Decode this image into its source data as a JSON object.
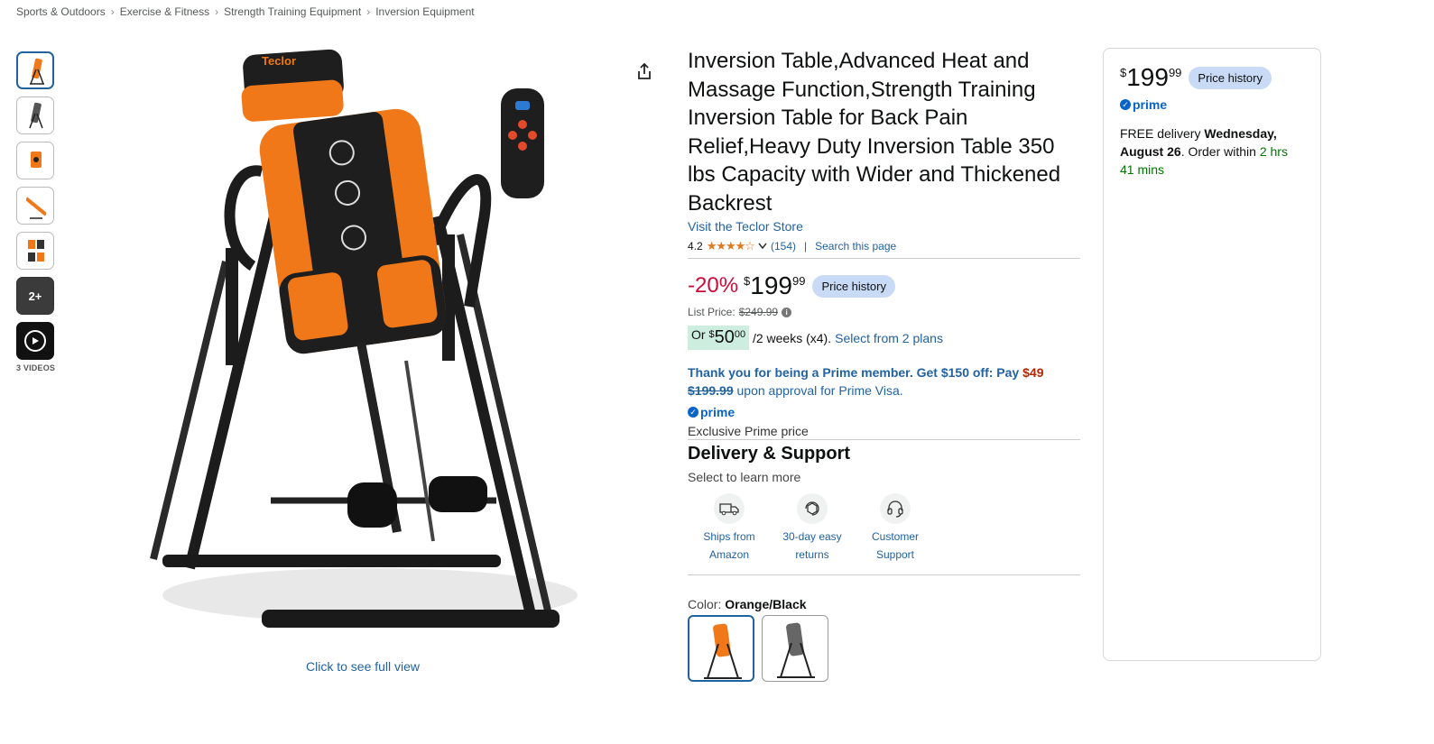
{
  "breadcrumb": [
    "Sports & Outdoors",
    "Exercise & Fitness",
    "Strength Training Equipment",
    "Inversion Equipment"
  ],
  "gallery": {
    "more_count": "2+",
    "videos_label": "3 VIDEOS",
    "full_view": "Click to see full view",
    "brand_text": "Teclor"
  },
  "product": {
    "title": "Inversion Table,Advanced Heat and Massage Function,Strength Training Inversion Table for Back Pain Relief,Heavy Duty Inversion Table 350 lbs Capacity with Wider and Thickened Backrest",
    "store_link": "Visit the Teclor Store",
    "rating": "4.2",
    "stars": "★★★★☆",
    "reviews": "(154)",
    "search_page": "Search this page"
  },
  "pricing": {
    "discount": "-20%",
    "currency": "$",
    "whole": "199",
    "fraction": "99",
    "history_label": "Price history",
    "list_price_label": "List Price:",
    "list_price": "$249.99",
    "install_or": "Or",
    "install_currency": "$",
    "install_whole": "50",
    "install_fraction": "00",
    "install_term": "/2 weeks (x4).",
    "install_plans": "Select from 2 plans"
  },
  "prime_offer": {
    "text": "Thank you for being a Prime member. Get $150 off: Pay",
    "pay_amount": "$49",
    "strike": "$199.99",
    "tail": "upon approval for Prime Visa.",
    "prime_label": "prime",
    "exclusive": "Exclusive Prime price"
  },
  "delivery": {
    "title": "Delivery & Support",
    "subtitle": "Select to learn more",
    "items": [
      {
        "line1": "Ships from",
        "line2": "Amazon",
        "icon": "truck-icon"
      },
      {
        "line1": "30-day easy",
        "line2": "returns",
        "icon": "return-box-icon"
      },
      {
        "line1": "Customer",
        "line2": "Support",
        "icon": "headset-icon"
      }
    ]
  },
  "color": {
    "label": "Color:",
    "value": "Orange/Black"
  },
  "buybox": {
    "currency": "$",
    "whole": "199",
    "fraction": "99",
    "history_label": "Price history",
    "prime_label": "prime",
    "delivery_prefix": "FREE delivery",
    "delivery_date": "Wednesday, August 26",
    "order_within": ". Order within",
    "countdown": "2 hrs 41 mins"
  },
  "colors": {
    "link": "#2162a1",
    "discount": "#cc0c39",
    "prime": "#0a63c9",
    "pill": "#c8daf5",
    "product_orange": "#f07818"
  }
}
